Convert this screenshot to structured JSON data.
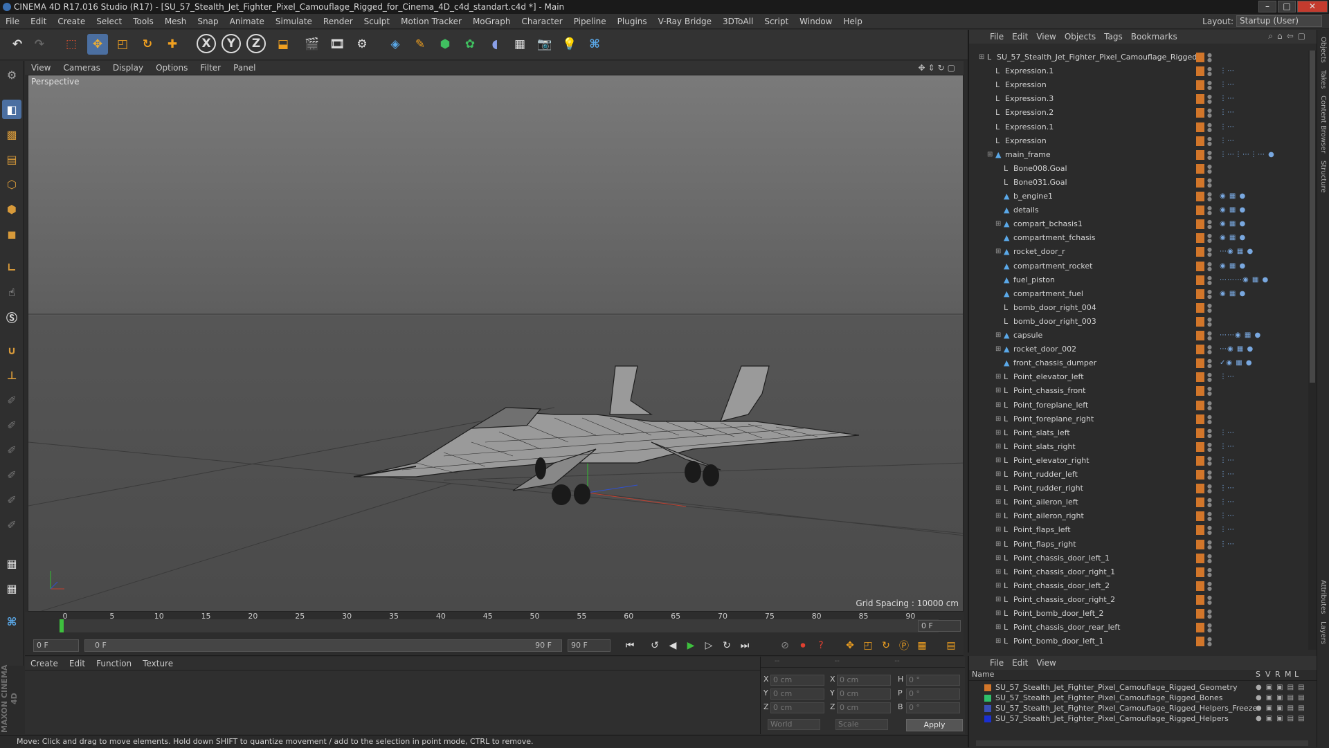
{
  "titlebar": {
    "text": "CINEMA 4D R17.016 Studio (R17) - [SU_57_Stealth_Jet_Fighter_Pixel_Camouflage_Rigged_for_Cinema_4D_c4d_standart.c4d *] - Main"
  },
  "menubar": [
    "File",
    "Edit",
    "Create",
    "Select",
    "Tools",
    "Mesh",
    "Snap",
    "Animate",
    "Simulate",
    "Render",
    "Sculpt",
    "Motion Tracker",
    "MoGraph",
    "Character",
    "Pipeline",
    "Plugins",
    "V-Ray Bridge",
    "3DToAll",
    "Script",
    "Window",
    "Help"
  ],
  "layout": {
    "label": "Layout:",
    "value": "Startup (User)"
  },
  "toolbar": {
    "axes": [
      "X",
      "Y",
      "Z"
    ]
  },
  "viewport": {
    "menu": [
      "View",
      "Cameras",
      "Display",
      "Options",
      "Filter",
      "Panel"
    ],
    "label": "Perspective",
    "grid_spacing": "Grid Spacing : 10000 cm"
  },
  "timeline": {
    "ticks": [
      "0",
      "5",
      "10",
      "15",
      "20",
      "25",
      "30",
      "35",
      "40",
      "45",
      "50",
      "55",
      "60",
      "65",
      "70",
      "75",
      "80",
      "85",
      "90"
    ],
    "end_frame": "0 F"
  },
  "transport": {
    "current": "0 F",
    "range_start": "0 F",
    "range_end": "90 F",
    "max": "90 F"
  },
  "material": {
    "menu": [
      "Create",
      "Edit",
      "Function",
      "Texture"
    ]
  },
  "coords": {
    "rows": [
      {
        "a": "X",
        "v1": "0 cm",
        "b": "X",
        "v2": "0 cm",
        "c": "H",
        "v3": "0 °"
      },
      {
        "a": "Y",
        "v1": "0 cm",
        "b": "Y",
        "v2": "0 cm",
        "c": "P",
        "v3": "0 °"
      },
      {
        "a": "Z",
        "v1": "0 cm",
        "b": "Z",
        "v2": "0 cm",
        "c": "B",
        "v3": "0 °"
      }
    ],
    "world": "World",
    "scale": "Scale",
    "apply": "Apply"
  },
  "status": "Move: Click and drag to move elements. Hold down SHIFT to quantize movement / add to the selection in point mode, CTRL to remove.",
  "objects": {
    "menu": [
      "File",
      "Edit",
      "View",
      "Objects",
      "Tags",
      "Bookmarks"
    ],
    "items": [
      {
        "name": "SU_57_Stealth_Jet_Fighter_Pixel_Camouflage_Rigged",
        "indent": 0,
        "icon": "null",
        "exp": "−"
      },
      {
        "name": "Expression.1",
        "indent": 1,
        "icon": "null",
        "tags": "⋮⋯"
      },
      {
        "name": "Expression",
        "indent": 1,
        "icon": "null",
        "tags": "⋮⋯"
      },
      {
        "name": "Expression.3",
        "indent": 1,
        "icon": "null",
        "tags": "⋮⋯"
      },
      {
        "name": "Expression.2",
        "indent": 1,
        "icon": "null",
        "tags": "⋮⋯"
      },
      {
        "name": "Expression.1",
        "indent": 1,
        "icon": "null",
        "tags": "⋮⋯"
      },
      {
        "name": "Expression",
        "indent": 1,
        "icon": "null",
        "tags": "⋮⋯"
      },
      {
        "name": "main_frame",
        "indent": 1,
        "icon": "poly",
        "exp": "−",
        "tags": "⋮⋯⋮⋯⋮⋯ ●"
      },
      {
        "name": "Bone008.Goal",
        "indent": 2,
        "icon": "null"
      },
      {
        "name": "Bone031.Goal",
        "indent": 2,
        "icon": "null"
      },
      {
        "name": "b_engine1",
        "indent": 2,
        "icon": "poly",
        "tags": "◉ ▦ ●"
      },
      {
        "name": "details",
        "indent": 2,
        "icon": "poly",
        "tags": "◉ ▦ ●"
      },
      {
        "name": "compart_bchasis1",
        "indent": 2,
        "icon": "poly",
        "exp": "+",
        "tags": "◉ ▦ ●"
      },
      {
        "name": "compartment_fchasis",
        "indent": 2,
        "icon": "poly",
        "tags": "◉ ▦ ●"
      },
      {
        "name": "rocket_door_r",
        "indent": 2,
        "icon": "poly",
        "exp": "+",
        "tags": "⋯◉ ▦ ●"
      },
      {
        "name": "compartment_rocket",
        "indent": 2,
        "icon": "poly",
        "tags": "◉ ▦ ●"
      },
      {
        "name": "fuel_piston",
        "indent": 2,
        "icon": "poly",
        "tags": "⋯⋯⋯◉ ▦ ●"
      },
      {
        "name": "compartment_fuel",
        "indent": 2,
        "icon": "poly",
        "tags": "◉ ▦ ●"
      },
      {
        "name": "bomb_door_right_004",
        "indent": 2,
        "icon": "null"
      },
      {
        "name": "bomb_door_right_003",
        "indent": 2,
        "icon": "null"
      },
      {
        "name": "capsule",
        "indent": 2,
        "icon": "poly",
        "exp": "+",
        "tags": "⋯⋯◉ ▦ ●"
      },
      {
        "name": "rocket_door_002",
        "indent": 2,
        "icon": "poly",
        "exp": "+",
        "tags": "⋯◉ ▦ ●"
      },
      {
        "name": "front_chassis_dumper",
        "indent": 2,
        "icon": "poly",
        "tags": "✓◉ ▦ ●"
      },
      {
        "name": "Point_elevator_left",
        "indent": 2,
        "icon": "null",
        "exp": "+",
        "tags": "⋮⋯"
      },
      {
        "name": "Point_chassis_front",
        "indent": 2,
        "icon": "null",
        "exp": "+"
      },
      {
        "name": "Point_foreplane_left",
        "indent": 2,
        "icon": "null",
        "exp": "+"
      },
      {
        "name": "Point_foreplane_right",
        "indent": 2,
        "icon": "null",
        "exp": "+"
      },
      {
        "name": "Point_slats_left",
        "indent": 2,
        "icon": "null",
        "exp": "+",
        "tags": "⋮⋯"
      },
      {
        "name": "Point_slats_right",
        "indent": 2,
        "icon": "null",
        "exp": "+",
        "tags": "⋮⋯"
      },
      {
        "name": "Point_elevator_right",
        "indent": 2,
        "icon": "null",
        "exp": "+",
        "tags": "⋮⋯"
      },
      {
        "name": "Point_rudder_left",
        "indent": 2,
        "icon": "null",
        "exp": "+",
        "tags": "⋮⋯"
      },
      {
        "name": "Point_rudder_right",
        "indent": 2,
        "icon": "null",
        "exp": "+",
        "tags": "⋮⋯"
      },
      {
        "name": "Point_aileron_left",
        "indent": 2,
        "icon": "null",
        "exp": "+",
        "tags": "⋮⋯"
      },
      {
        "name": "Point_aileron_right",
        "indent": 2,
        "icon": "null",
        "exp": "+",
        "tags": "⋮⋯"
      },
      {
        "name": "Point_flaps_left",
        "indent": 2,
        "icon": "null",
        "exp": "+",
        "tags": "⋮⋯"
      },
      {
        "name": "Point_flaps_right",
        "indent": 2,
        "icon": "null",
        "exp": "+",
        "tags": "⋮⋯"
      },
      {
        "name": "Point_chassis_door_left_1",
        "indent": 2,
        "icon": "null",
        "exp": "+"
      },
      {
        "name": "Point_chassis_door_right_1",
        "indent": 2,
        "icon": "null",
        "exp": "+"
      },
      {
        "name": "Point_chassis_door_left_2",
        "indent": 2,
        "icon": "null",
        "exp": "+"
      },
      {
        "name": "Point_chassis_door_right_2",
        "indent": 2,
        "icon": "null",
        "exp": "+"
      },
      {
        "name": "Point_bomb_door_left_2",
        "indent": 2,
        "icon": "null",
        "exp": "+"
      },
      {
        "name": "Point_chassis_door_rear_left",
        "indent": 2,
        "icon": "null",
        "exp": "+"
      },
      {
        "name": "Point_bomb_door_left_1",
        "indent": 2,
        "icon": "null",
        "exp": "+"
      }
    ]
  },
  "layers": {
    "menu": [
      "File",
      "Edit",
      "View"
    ],
    "header": {
      "name": "Name",
      "cols": [
        "S",
        "V",
        "R",
        "M",
        "L"
      ]
    },
    "items": [
      {
        "name": "SU_57_Stealth_Jet_Fighter_Pixel_Camouflage_Rigged_Geometry",
        "color": "#d2762a"
      },
      {
        "name": "SU_57_Stealth_Jet_Fighter_Pixel_Camouflage_Rigged_Bones",
        "color": "#2fbf6a"
      },
      {
        "name": "SU_57_Stealth_Jet_Fighter_Pixel_Camouflage_Rigged_Helpers_Freeze",
        "color": "#3a4fb8"
      },
      {
        "name": "SU_57_Stealth_Jet_Fighter_Pixel_Camouflage_Rigged_Helpers",
        "color": "#1a2fd0"
      }
    ]
  },
  "sidetabs": [
    "Objects",
    "Takes",
    "Content Browser",
    "Structure",
    "Attributes",
    "Layers"
  ],
  "maxon": "MAXON CINEMA 4D"
}
